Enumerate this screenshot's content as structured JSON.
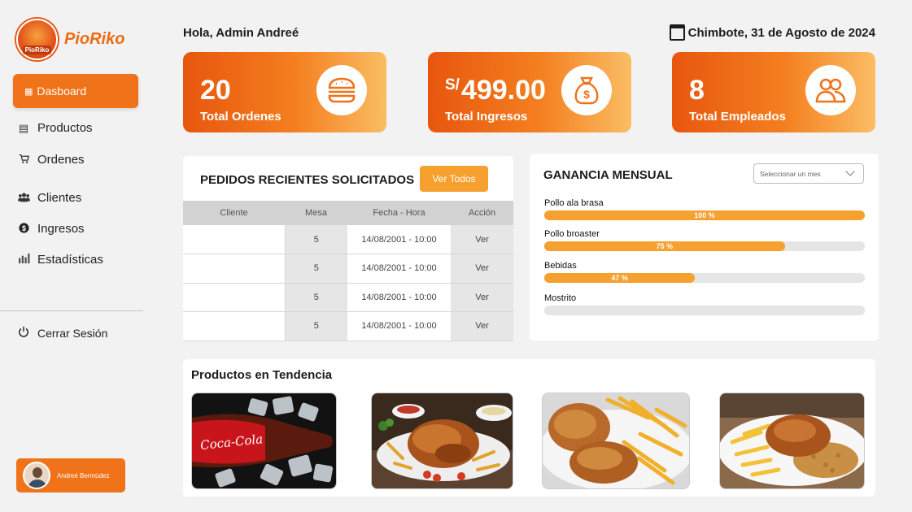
{
  "brand": {
    "name": "PioRiko",
    "badge": "PioRiko"
  },
  "sidebar": {
    "items": [
      {
        "label": "Dasboard",
        "icon": "dashboard-icon",
        "active": true
      },
      {
        "label": "Productos",
        "icon": "products-icon"
      },
      {
        "label": "Ordenes",
        "icon": "cart-icon"
      },
      {
        "label": "Clientes",
        "icon": "users-icon"
      },
      {
        "label": "Ingresos",
        "icon": "dollar-coin-icon"
      },
      {
        "label": "Estadísticas",
        "icon": "bar-chart-icon"
      }
    ],
    "logout": "Cerrar Sesión",
    "user": "Andreé Bermúdez"
  },
  "header": {
    "greeting": "Hola, Admin Andreé",
    "date": "Chimbote, 31 de Agosto de 2024"
  },
  "stats": [
    {
      "value": "20",
      "label": "Total Ordenes",
      "icon": "burger-icon"
    },
    {
      "currency": "S/",
      "value": "499.00",
      "label": "Total Ingresos",
      "icon": "money-bag-icon"
    },
    {
      "value": "8",
      "label": "Total Empleados",
      "icon": "employees-icon"
    }
  ],
  "orders": {
    "title": "PEDIDOS RECIENTES SOLICITADOS",
    "button": "Ver Todos",
    "columns": [
      "Cliente",
      "Mesa",
      "Fecha - Hora",
      "Acción"
    ],
    "rows": [
      {
        "cliente": "",
        "mesa": "5",
        "fecha": "14/08/2001 - 10:00",
        "accion": "Ver"
      },
      {
        "cliente": "",
        "mesa": "5",
        "fecha": "14/08/2001 - 10:00",
        "accion": "Ver"
      },
      {
        "cliente": "",
        "mesa": "5",
        "fecha": "14/08/2001 - 10:00",
        "accion": "Ver"
      },
      {
        "cliente": "",
        "mesa": "5",
        "fecha": "14/08/2001 - 10:00",
        "accion": "Ver"
      }
    ]
  },
  "ganancia": {
    "title": "GANANCIA MENSUAL",
    "select_placeholder": "Seleccionar un mes",
    "items": [
      {
        "label": "Pollo ala brasa",
        "percent": 100,
        "text": "100 %"
      },
      {
        "label": "Pollo broaster",
        "percent": 75,
        "text": "75 %"
      },
      {
        "label": "Bebidas",
        "percent": 47,
        "text": "47 %"
      },
      {
        "label": "Mostrito",
        "percent": 0,
        "text": ""
      }
    ]
  },
  "tendencia": {
    "title": "Productos en Tendencia",
    "products": [
      {
        "name": "coca-cola-image"
      },
      {
        "name": "pollo-a-la-brasa-image"
      },
      {
        "name": "pollo-broaster-image"
      },
      {
        "name": "mostrito-image"
      }
    ]
  },
  "colors": {
    "accent": "#f07219",
    "accent_light": "#f6a12f",
    "background": "#f2f2f2"
  }
}
